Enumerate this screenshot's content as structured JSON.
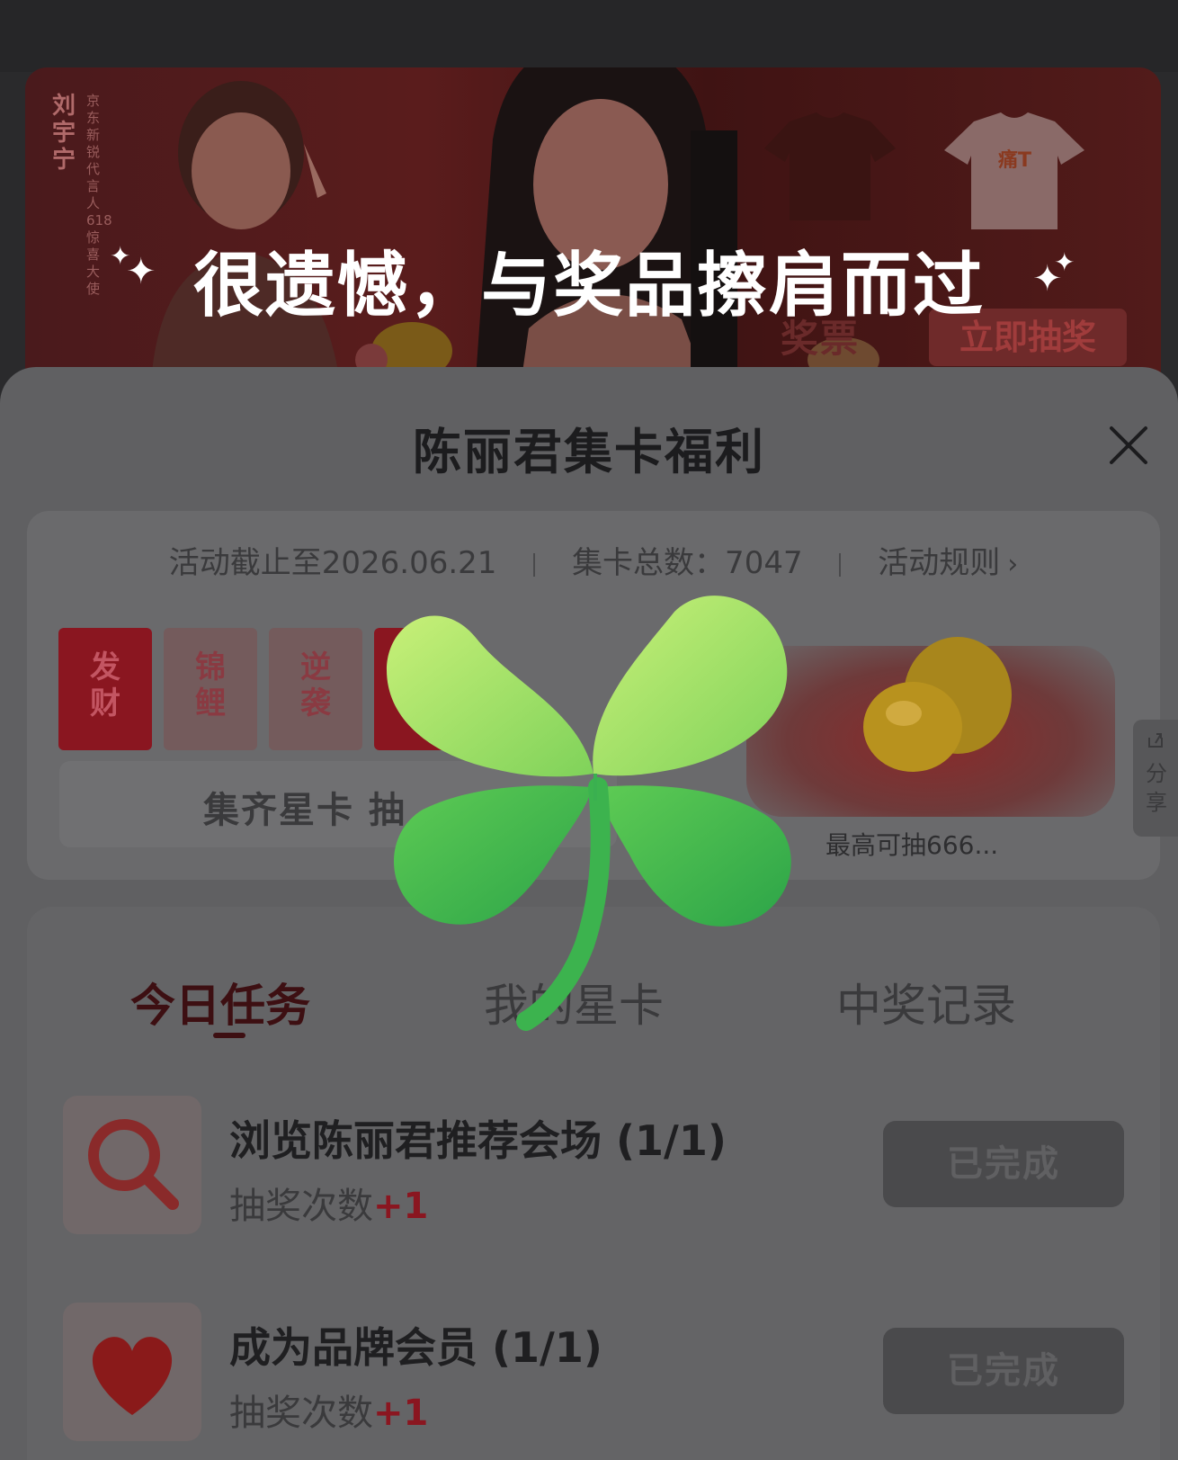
{
  "banner": {
    "star_name": "刘宇宁",
    "star_desc": "京东新锐代言人 618惊喜大使",
    "tee_label": "痛T",
    "ticket_text": "奖票",
    "draw_button": "立即抽奖"
  },
  "result": {
    "headline": "很遗憾，与奖品擦肩而过"
  },
  "sheet": {
    "title": "陈丽君集卡福利",
    "info": {
      "deadline": "活动截止至2026.06.21",
      "total": "集卡总数：7047",
      "rules": "活动规则"
    },
    "star_cards": [
      {
        "label": "发财",
        "collected": true
      },
      {
        "label": "锦鲤",
        "collected": false
      },
      {
        "label": "逆袭",
        "collected": false
      },
      {
        "label": "",
        "collected": true
      }
    ],
    "collect_bar": "集齐星卡 抽",
    "prize_text": "最高可抽666...",
    "share": "分享"
  },
  "tasks": {
    "tabs": [
      {
        "label": "今日任务",
        "active": true
      },
      {
        "label": "我的星卡",
        "active": false
      },
      {
        "label": "中奖记录",
        "active": false
      }
    ],
    "items": [
      {
        "title": "浏览陈丽君推荐会场 (1/1)",
        "reward_label": "抽奖次数",
        "reward_value": "+1",
        "button": "已完成",
        "icon": "magnifier-icon"
      },
      {
        "title": "成为品牌会员 (1/1)",
        "reward_label": "抽奖次数",
        "reward_value": "+1",
        "button": "已完成",
        "icon": "heart-icon"
      }
    ]
  },
  "colors": {
    "accent": "#8a1620",
    "clover_light": "#b8e86a",
    "clover_dark": "#2fb24a"
  }
}
